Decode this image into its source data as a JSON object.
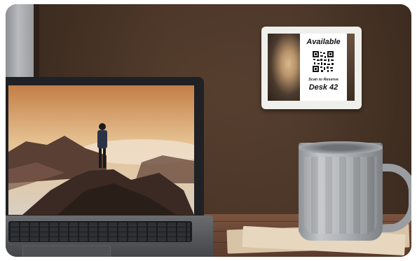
{
  "sign": {
    "status": "Available",
    "scan_text": "Scan to Reserve",
    "desk": "Desk 42"
  },
  "colors": {
    "wall": "#4b3628",
    "desk": "#6a4736",
    "mug": "#aeb2b6",
    "laptop": "#202124"
  },
  "icons": [
    "qr-code-icon"
  ]
}
